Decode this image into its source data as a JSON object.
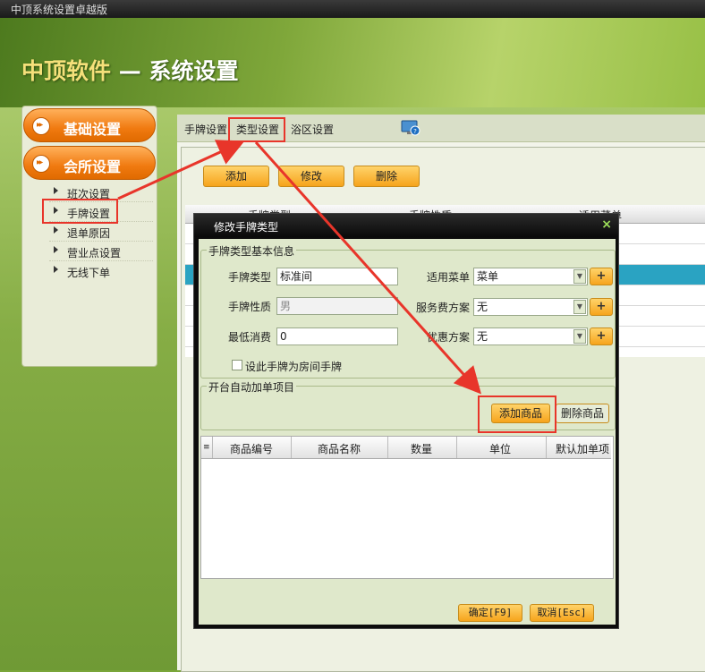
{
  "window": {
    "title": "中顶系统设置卓越版"
  },
  "banner": {
    "brand": "中顶软件",
    "separator": "—",
    "section": "系统设置"
  },
  "leftnav": {
    "main_items": [
      "基础设置",
      "会所设置"
    ],
    "sub_items": [
      "班次设置",
      "手牌设置",
      "退单原因",
      "营业点设置",
      "无线下单"
    ]
  },
  "tabs": [
    "手牌设置",
    "类型设置",
    "浴区设置"
  ],
  "toolbar": {
    "add": "添加",
    "edit": "修改",
    "delete": "删除"
  },
  "grid": {
    "columns": [
      "手牌类型",
      "手牌性质",
      "适用菜单"
    ]
  },
  "dialog": {
    "title": "修改手牌类型",
    "close": "×",
    "basic_group": "手牌类型基本信息",
    "fields": {
      "type_label": "手牌类型",
      "type_value": "标准间",
      "nature_label": "手牌性质",
      "nature_value": "男",
      "min_label": "最低消费",
      "min_value": "0",
      "menu_label": "适用菜单",
      "menu_value": "菜单",
      "fee_label": "服务费方案",
      "fee_value": "无",
      "discount_label": "优惠方案",
      "discount_value": "无",
      "checkbox_label": "设此手牌为房间手牌"
    },
    "auto_group": "开台自动加单项目",
    "add_goods": "添加商品",
    "del_goods": "删除商品",
    "goods_columns": [
      "商品编号",
      "商品名称",
      "数量",
      "单位",
      "默认加单项"
    ],
    "ok": "确定[F9]",
    "cancel": "取消[Esc]"
  },
  "colors": {
    "highlight_red": "#e8352a",
    "accent_orange": "#f07a10",
    "selected_row": "#2aa3c2"
  }
}
